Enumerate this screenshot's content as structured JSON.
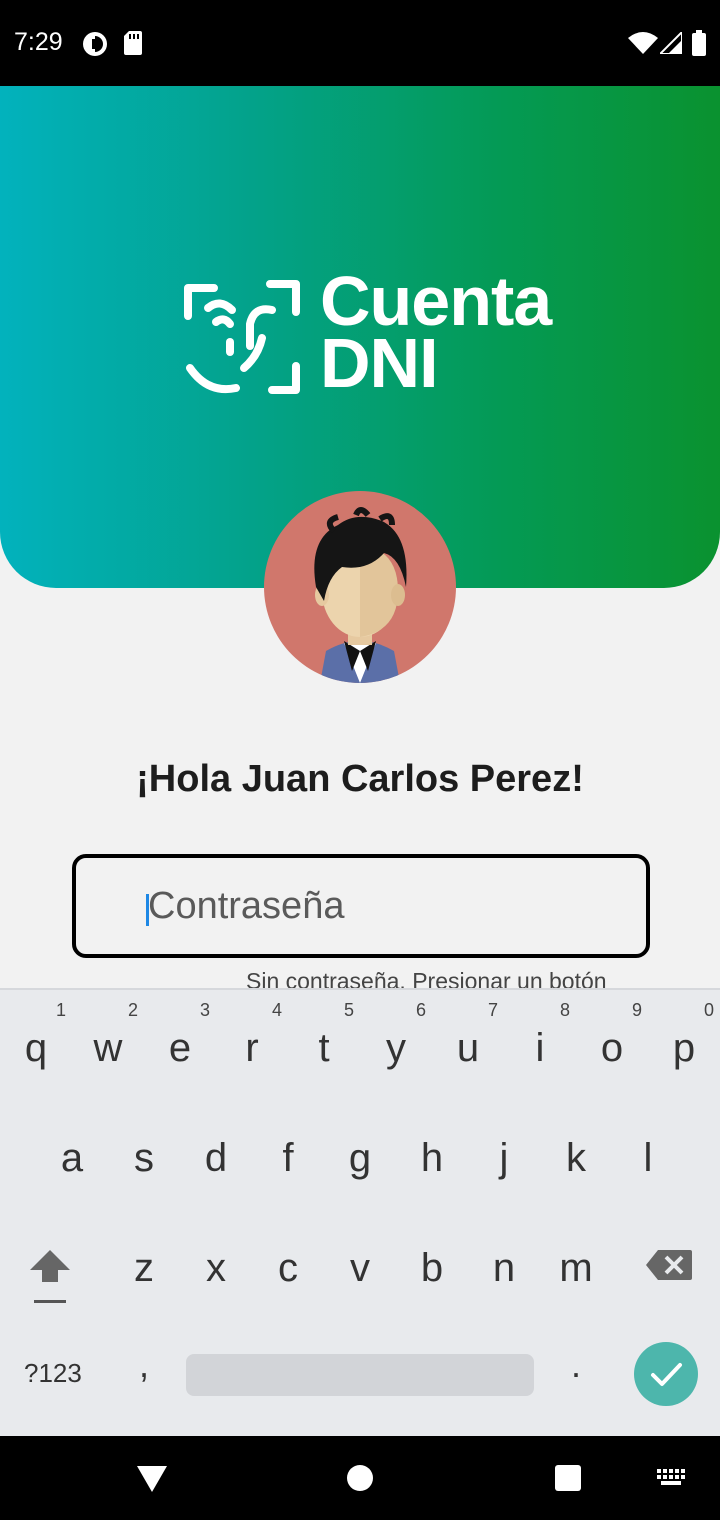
{
  "status_bar": {
    "time": "7:29"
  },
  "app": {
    "brand_line1": "Cuenta",
    "brand_line2": "DNI",
    "greeting": "¡Hola Juan Carlos Perez!",
    "password_placeholder": "Contraseña",
    "hint_text": "Sin contraseña. Presionar un botón"
  },
  "keyboard": {
    "row1": [
      "q",
      "w",
      "e",
      "r",
      "t",
      "y",
      "u",
      "i",
      "o",
      "p"
    ],
    "row1_hints": [
      "1",
      "2",
      "3",
      "4",
      "5",
      "6",
      "7",
      "8",
      "9",
      "0"
    ],
    "row2": [
      "a",
      "s",
      "d",
      "f",
      "g",
      "h",
      "j",
      "k",
      "l"
    ],
    "row3": [
      "z",
      "x",
      "c",
      "v",
      "b",
      "n",
      "m"
    ],
    "symbols_label": "?123",
    "comma": ",",
    "period": "."
  },
  "colors": {
    "header_gradient_start": "#02b2bd",
    "header_gradient_end": "#0a922f",
    "avatar_bg": "#d0776c",
    "enter_key": "#4db6ac",
    "caret": "#1e88e5"
  },
  "icons": {
    "status": [
      "data-saver-icon",
      "sd-card-icon",
      "wifi-icon",
      "cell-signal-icon",
      "battery-icon"
    ],
    "navigation": [
      "back-icon",
      "home-icon",
      "recents-icon",
      "keyboard-switch-icon"
    ]
  }
}
